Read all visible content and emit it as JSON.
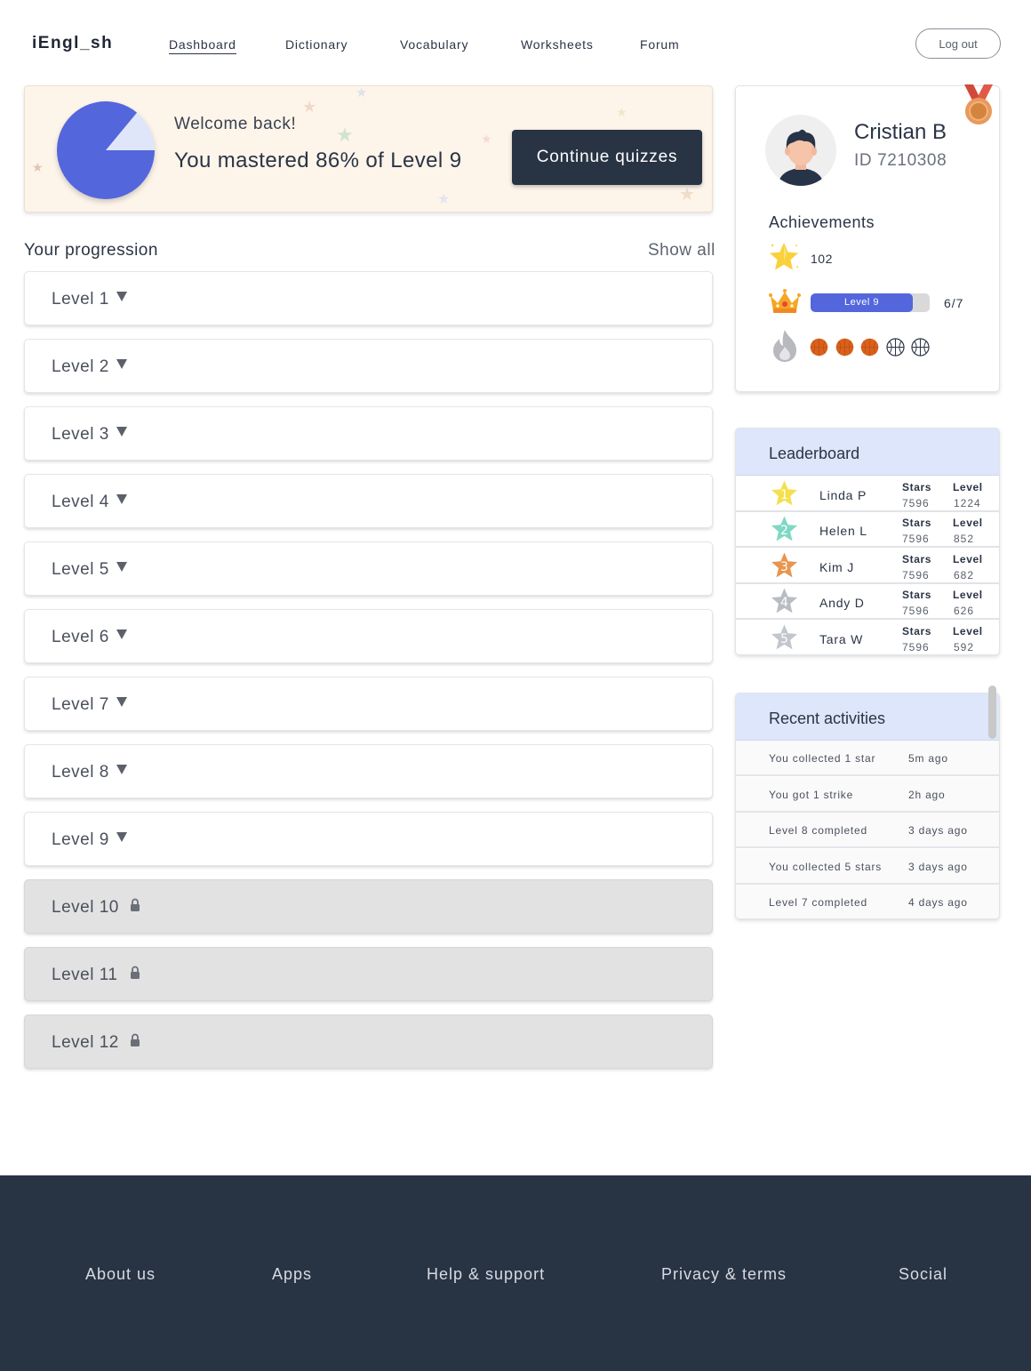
{
  "header": {
    "logo": "iEngl_sh",
    "nav": [
      "Dashboard",
      "Dictionary",
      "Vocabulary",
      "Worksheets",
      "Forum"
    ],
    "active_nav": "Dashboard",
    "logout_label": "Log out"
  },
  "hero": {
    "welcome": "Welcome back!",
    "mastered": "You mastered 86% of Level 9",
    "mastered_fraction": 0.86,
    "cta": "Continue quizzes"
  },
  "progression": {
    "title": "Your progression",
    "show_all": "Show all",
    "levels": [
      {
        "label": "Level 1",
        "locked": false
      },
      {
        "label": "Level 2",
        "locked": false
      },
      {
        "label": "Level 3",
        "locked": false
      },
      {
        "label": "Level 4",
        "locked": false
      },
      {
        "label": "Level 5",
        "locked": false
      },
      {
        "label": "Level 6",
        "locked": false
      },
      {
        "label": "Level 7",
        "locked": false
      },
      {
        "label": "Level 8",
        "locked": false
      },
      {
        "label": "Level 9",
        "locked": false
      },
      {
        "label": "Level 10",
        "locked": true
      },
      {
        "label": "Level 11",
        "locked": true
      },
      {
        "label": "Level 12",
        "locked": true
      }
    ]
  },
  "profile": {
    "name": "Cristian B",
    "id": "ID 7210308",
    "achievements_title": "Achievements",
    "stars": "102",
    "level_label": "Level 9",
    "level_progress": "6/7",
    "level_progress_fraction": 0.857,
    "streak": {
      "filled": 3,
      "total": 5
    }
  },
  "leaderboard": {
    "title": "Leaderboard",
    "stars_header": "Stars",
    "level_header": "Level",
    "rows": [
      {
        "rank": "1",
        "name": "Linda P",
        "stars": "7596",
        "level": "1224",
        "color": "#f4e04d"
      },
      {
        "rank": "2",
        "name": "Helen L",
        "stars": "7596",
        "level": "852",
        "color": "#7fd8c4"
      },
      {
        "rank": "3",
        "name": "Kim J",
        "stars": "7596",
        "level": "682",
        "color": "#e8954e"
      },
      {
        "rank": "4",
        "name": "Andy D",
        "stars": "7596",
        "level": "626",
        "color": "#b9bcc3"
      },
      {
        "rank": "5",
        "name": "Tara W",
        "stars": "7596",
        "level": "592",
        "color": "#c3c6cc"
      }
    ]
  },
  "recent": {
    "title": "Recent activities",
    "rows": [
      {
        "text": "You collected 1 star",
        "time": "5m ago"
      },
      {
        "text": "You got 1 strike",
        "time": "2h ago"
      },
      {
        "text": "Level 8 completed",
        "time": "3 days ago"
      },
      {
        "text": "You collected 5 stars",
        "time": "3 days ago"
      },
      {
        "text": "Level 7 completed",
        "time": "4 days ago"
      }
    ]
  },
  "footer": {
    "links": [
      "About us",
      "Apps",
      "Help & support",
      "Privacy & terms",
      "Social"
    ]
  },
  "colors": {
    "accent": "#5366dc",
    "navy": "#283344",
    "hero_bg": "#fdf4ea",
    "panel_head": "#dde6fa",
    "locked_bg": "#e2e2e2",
    "ball": "#d9601c"
  }
}
